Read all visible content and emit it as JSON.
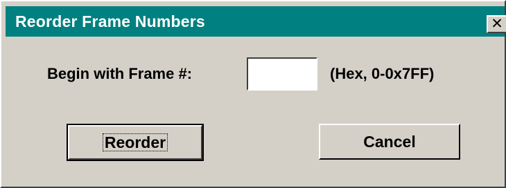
{
  "window": {
    "title": "Reorder Frame Numbers",
    "close_symbol": "✕",
    "close_icon": "close-icon",
    "title_bar_color": "#008080",
    "face_color": "#d4d0c8"
  },
  "form": {
    "begin_label": "Begin with Frame #:",
    "frame_value": "",
    "hint": "(Hex, 0-0x7FF)"
  },
  "buttons": {
    "reorder_label": "Reorder",
    "cancel_label": "Cancel"
  }
}
